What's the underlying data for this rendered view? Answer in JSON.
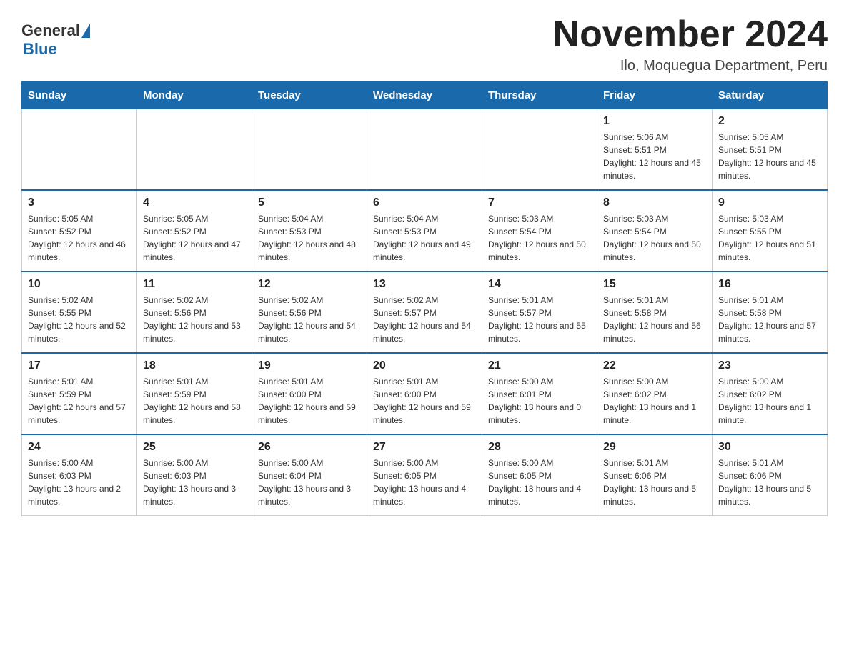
{
  "header": {
    "logo_general": "General",
    "logo_blue": "Blue",
    "month_title": "November 2024",
    "subtitle": "Ilo, Moquegua Department, Peru"
  },
  "days_of_week": [
    "Sunday",
    "Monday",
    "Tuesday",
    "Wednesday",
    "Thursday",
    "Friday",
    "Saturday"
  ],
  "weeks": [
    [
      {
        "day": "",
        "info": ""
      },
      {
        "day": "",
        "info": ""
      },
      {
        "day": "",
        "info": ""
      },
      {
        "day": "",
        "info": ""
      },
      {
        "day": "",
        "info": ""
      },
      {
        "day": "1",
        "info": "Sunrise: 5:06 AM\nSunset: 5:51 PM\nDaylight: 12 hours and 45 minutes."
      },
      {
        "day": "2",
        "info": "Sunrise: 5:05 AM\nSunset: 5:51 PM\nDaylight: 12 hours and 45 minutes."
      }
    ],
    [
      {
        "day": "3",
        "info": "Sunrise: 5:05 AM\nSunset: 5:52 PM\nDaylight: 12 hours and 46 minutes."
      },
      {
        "day": "4",
        "info": "Sunrise: 5:05 AM\nSunset: 5:52 PM\nDaylight: 12 hours and 47 minutes."
      },
      {
        "day": "5",
        "info": "Sunrise: 5:04 AM\nSunset: 5:53 PM\nDaylight: 12 hours and 48 minutes."
      },
      {
        "day": "6",
        "info": "Sunrise: 5:04 AM\nSunset: 5:53 PM\nDaylight: 12 hours and 49 minutes."
      },
      {
        "day": "7",
        "info": "Sunrise: 5:03 AM\nSunset: 5:54 PM\nDaylight: 12 hours and 50 minutes."
      },
      {
        "day": "8",
        "info": "Sunrise: 5:03 AM\nSunset: 5:54 PM\nDaylight: 12 hours and 50 minutes."
      },
      {
        "day": "9",
        "info": "Sunrise: 5:03 AM\nSunset: 5:55 PM\nDaylight: 12 hours and 51 minutes."
      }
    ],
    [
      {
        "day": "10",
        "info": "Sunrise: 5:02 AM\nSunset: 5:55 PM\nDaylight: 12 hours and 52 minutes."
      },
      {
        "day": "11",
        "info": "Sunrise: 5:02 AM\nSunset: 5:56 PM\nDaylight: 12 hours and 53 minutes."
      },
      {
        "day": "12",
        "info": "Sunrise: 5:02 AM\nSunset: 5:56 PM\nDaylight: 12 hours and 54 minutes."
      },
      {
        "day": "13",
        "info": "Sunrise: 5:02 AM\nSunset: 5:57 PM\nDaylight: 12 hours and 54 minutes."
      },
      {
        "day": "14",
        "info": "Sunrise: 5:01 AM\nSunset: 5:57 PM\nDaylight: 12 hours and 55 minutes."
      },
      {
        "day": "15",
        "info": "Sunrise: 5:01 AM\nSunset: 5:58 PM\nDaylight: 12 hours and 56 minutes."
      },
      {
        "day": "16",
        "info": "Sunrise: 5:01 AM\nSunset: 5:58 PM\nDaylight: 12 hours and 57 minutes."
      }
    ],
    [
      {
        "day": "17",
        "info": "Sunrise: 5:01 AM\nSunset: 5:59 PM\nDaylight: 12 hours and 57 minutes."
      },
      {
        "day": "18",
        "info": "Sunrise: 5:01 AM\nSunset: 5:59 PM\nDaylight: 12 hours and 58 minutes."
      },
      {
        "day": "19",
        "info": "Sunrise: 5:01 AM\nSunset: 6:00 PM\nDaylight: 12 hours and 59 minutes."
      },
      {
        "day": "20",
        "info": "Sunrise: 5:01 AM\nSunset: 6:00 PM\nDaylight: 12 hours and 59 minutes."
      },
      {
        "day": "21",
        "info": "Sunrise: 5:00 AM\nSunset: 6:01 PM\nDaylight: 13 hours and 0 minutes."
      },
      {
        "day": "22",
        "info": "Sunrise: 5:00 AM\nSunset: 6:02 PM\nDaylight: 13 hours and 1 minute."
      },
      {
        "day": "23",
        "info": "Sunrise: 5:00 AM\nSunset: 6:02 PM\nDaylight: 13 hours and 1 minute."
      }
    ],
    [
      {
        "day": "24",
        "info": "Sunrise: 5:00 AM\nSunset: 6:03 PM\nDaylight: 13 hours and 2 minutes."
      },
      {
        "day": "25",
        "info": "Sunrise: 5:00 AM\nSunset: 6:03 PM\nDaylight: 13 hours and 3 minutes."
      },
      {
        "day": "26",
        "info": "Sunrise: 5:00 AM\nSunset: 6:04 PM\nDaylight: 13 hours and 3 minutes."
      },
      {
        "day": "27",
        "info": "Sunrise: 5:00 AM\nSunset: 6:05 PM\nDaylight: 13 hours and 4 minutes."
      },
      {
        "day": "28",
        "info": "Sunrise: 5:00 AM\nSunset: 6:05 PM\nDaylight: 13 hours and 4 minutes."
      },
      {
        "day": "29",
        "info": "Sunrise: 5:01 AM\nSunset: 6:06 PM\nDaylight: 13 hours and 5 minutes."
      },
      {
        "day": "30",
        "info": "Sunrise: 5:01 AM\nSunset: 6:06 PM\nDaylight: 13 hours and 5 minutes."
      }
    ]
  ]
}
